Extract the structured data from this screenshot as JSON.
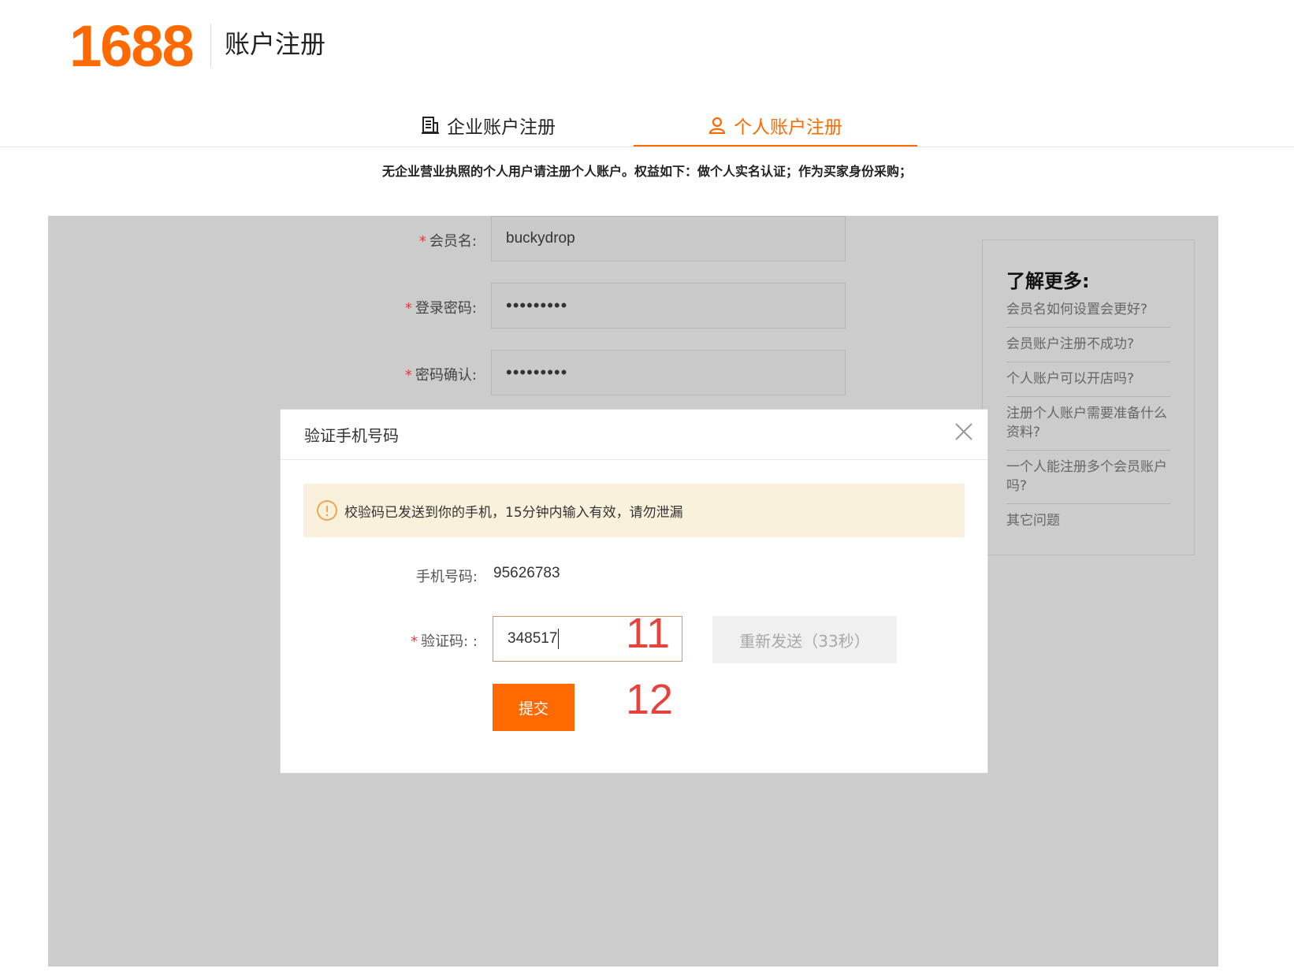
{
  "header": {
    "logo_text": "1688",
    "page_title": "账户注册"
  },
  "tabs": [
    {
      "label": "企业账户注册",
      "icon": "building-icon",
      "active": false
    },
    {
      "label": "个人账户注册",
      "icon": "user-icon",
      "active": true
    }
  ],
  "notice": "无企业营业执照的个人用户请注册个人账户。权益如下：做个人实名认证；作为买家身份采购；",
  "form": {
    "required_mark": "*",
    "member_name_label": "会员名:",
    "member_name_value": "buckydrop",
    "password_label": "登录密码:",
    "password_value": "•••••••••",
    "confirm_label": "密码确认:",
    "confirm_value": "•••••••••"
  },
  "help": {
    "title": "了解更多:",
    "items": [
      "会员名如何设置会更好?",
      "会员账户注册不成功?",
      "个人账户可以开店吗?",
      "注册个人账户需要准备什么资料?",
      "一个人能注册多个会员账户吗?",
      "其它问题"
    ]
  },
  "modal": {
    "title": "验证手机号码",
    "alert_text": "校验码已发送到你的手机，15分钟内输入有效，请勿泄漏",
    "phone_label": "手机号码:",
    "phone_value": "95626783",
    "code_label": "验证码: :",
    "code_value": "348517",
    "resend_label": "重新发送（33秒）",
    "submit_label": "提交"
  },
  "annotations": {
    "code_marker": "11",
    "submit_marker": "12"
  },
  "colors": {
    "brand": "#ff6a00",
    "annotation": "#e8433a",
    "overlay": "#cccccc",
    "alert_bg": "#faf1dc"
  }
}
